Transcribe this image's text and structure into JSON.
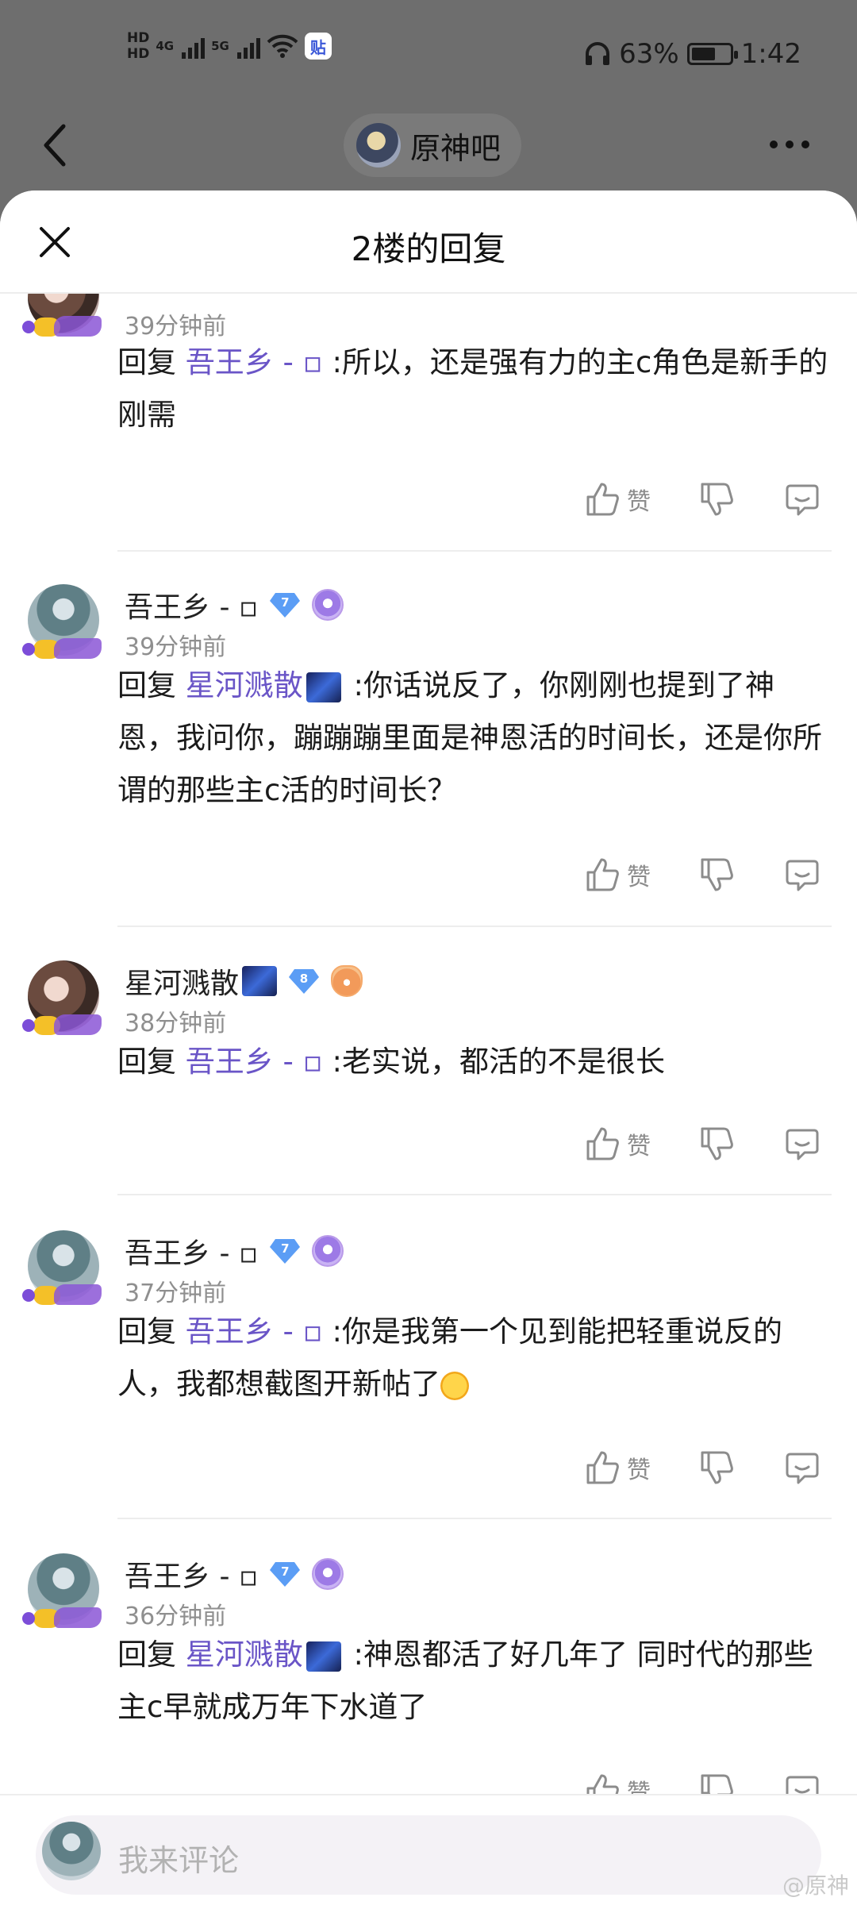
{
  "status_bar": {
    "hd1": "HD",
    "hd2": "HD",
    "net1": "4G",
    "net2": "5G",
    "app_badge": "贴",
    "battery": "63%",
    "time": "1:42"
  },
  "nav": {
    "forum_name": "原神吧"
  },
  "sheet": {
    "title": "2楼的回复"
  },
  "comments": [
    {
      "time": "39分钟前",
      "reply_prefix": "回复",
      "mention": "吾王乡 - ▫",
      "text": ":所以，还是强有力的主c角色是新手的刚需",
      "like_label": "赞"
    },
    {
      "user": "吾王乡 - ▫",
      "level": "7",
      "time": "39分钟前",
      "reply_prefix": "回复",
      "mention": "星河溅散",
      "text": ":你话说反了，你刚刚也提到了神恩，我问你，蹦蹦蹦里面是神恩活的时间长，还是你所谓的那些主c活的时间长？",
      "like_label": "赞"
    },
    {
      "user": "星河溅散",
      "level": "8",
      "time": "38分钟前",
      "reply_prefix": "回复",
      "mention": "吾王乡 - ▫",
      "text": ":老实说，都活的不是很长",
      "like_label": "赞"
    },
    {
      "user": "吾王乡 - ▫",
      "level": "7",
      "time": "37分钟前",
      "reply_prefix": "回复",
      "mention": "吾王乡 - ▫",
      "text": ":你是我第一个见到能把轻重说反的人，我都想截图开新帖了",
      "like_label": "赞"
    },
    {
      "user": "吾王乡 - ▫",
      "level": "7",
      "time": "36分钟前",
      "reply_prefix": "回复",
      "mention": "星河溅散",
      "text": ":神恩都活了好几年了 同时代的那些主c早就成万年下水道了",
      "like_label": "赞"
    }
  ],
  "footer": {
    "placeholder": "我来评论",
    "watermark": "@原神"
  },
  "colors": {
    "mention": "#6a55c7",
    "level_badge": "#5b9df5",
    "muted": "#8f8f8f"
  }
}
